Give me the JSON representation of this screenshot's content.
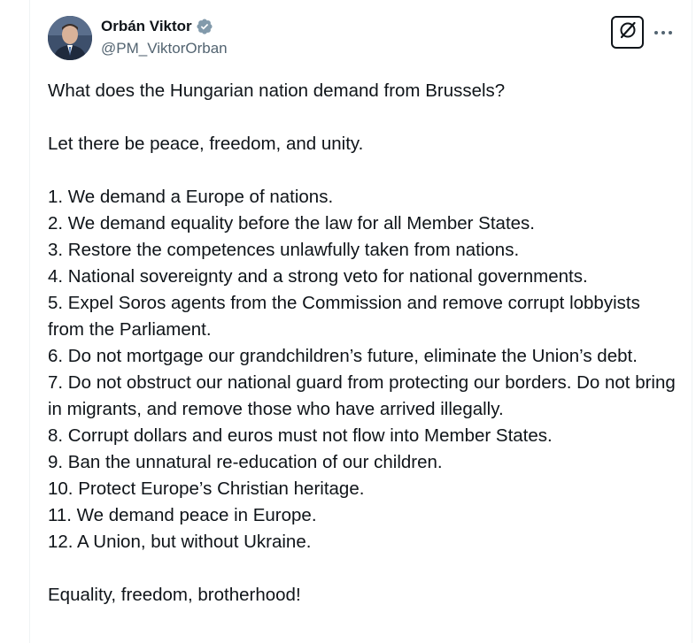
{
  "author": {
    "display_name": "Orbán Viktor",
    "handle": "@PM_ViktorOrban",
    "verified": true,
    "verified_color": "#829aab"
  },
  "actions": {
    "grok_icon": "grok-icon",
    "more_icon": "more-dots-icon"
  },
  "tweet": {
    "intro": "What does the Hungarian nation demand from Brussels?",
    "slogan": "Let there be peace, freedom, and unity.",
    "demands": [
      "1. We demand a Europe of nations.",
      "2. We demand equality before the law for all Member States.",
      "3. Restore the competences unlawfully taken from nations.",
      "4. National sovereignty and a strong veto for national governments.",
      "5. Expel Soros agents from the Commission and remove corrupt lobbyists from the Parliament.",
      "6. Do not mortgage our grandchildren’s future, eliminate the Union’s debt.",
      "7. Do not obstruct our national guard from protecting our borders. Do not bring in migrants, and remove those who have arrived illegally.",
      "8. Corrupt dollars and euros must not flow into Member States.",
      "9. Ban the unnatural re-education of our children.",
      "10. Protect Europe’s Christian heritage.",
      "11. We demand peace in Europe.",
      "12. A Union, but without Ukraine."
    ],
    "closing": "Equality, freedom, brotherhood!"
  }
}
